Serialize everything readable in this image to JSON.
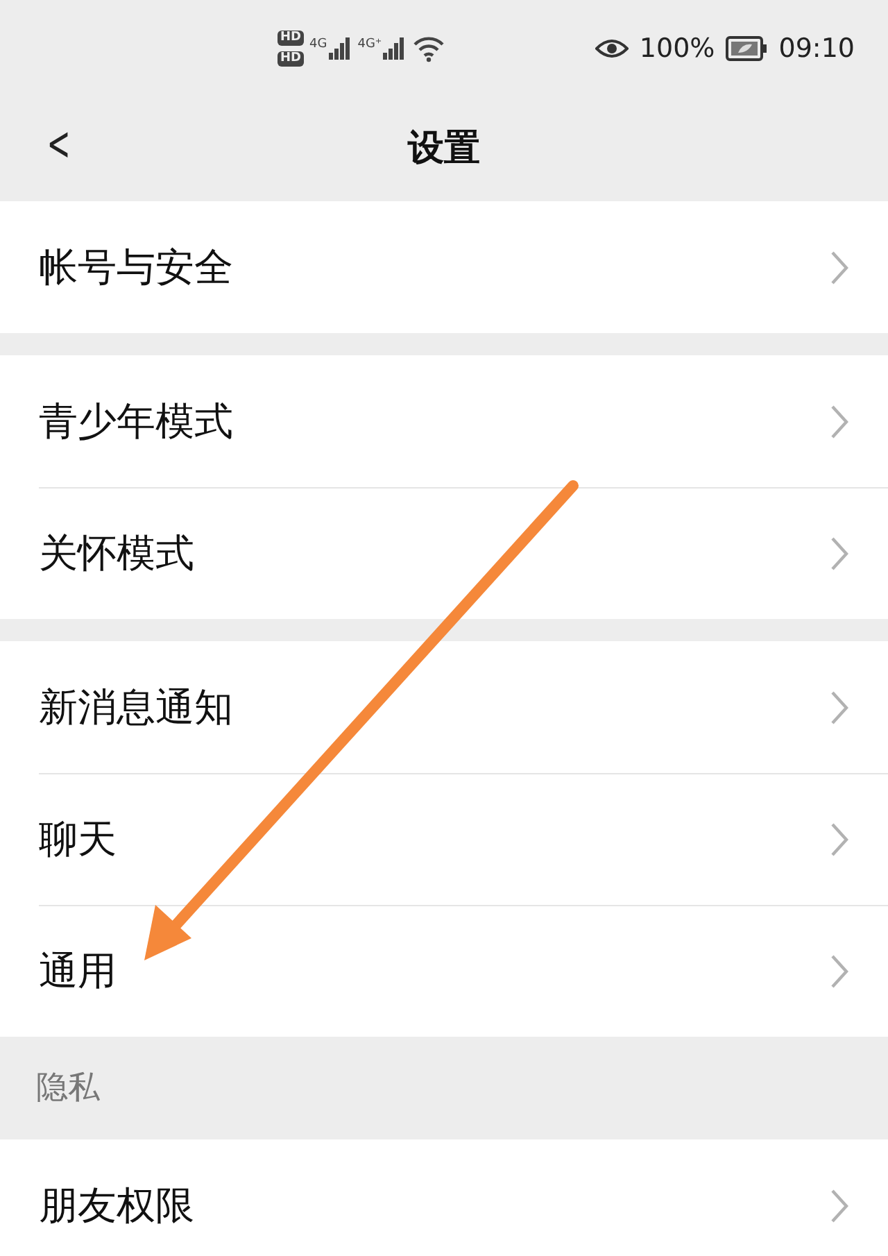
{
  "status_bar": {
    "hd_badges": [
      "HD",
      "HD"
    ],
    "networks": [
      "4G",
      "4G⁺"
    ],
    "battery": "100%",
    "time": "09:10"
  },
  "header": {
    "back": "<",
    "title": "设置"
  },
  "groups": [
    {
      "items": [
        {
          "label": "帐号与安全"
        }
      ]
    },
    {
      "items": [
        {
          "label": "青少年模式"
        },
        {
          "label": "关怀模式"
        }
      ]
    },
    {
      "items": [
        {
          "label": "新消息通知"
        },
        {
          "label": "聊天"
        },
        {
          "label": "通用"
        }
      ]
    },
    {
      "title": "隐私",
      "items": [
        {
          "label": "朋友权限"
        }
      ]
    }
  ]
}
